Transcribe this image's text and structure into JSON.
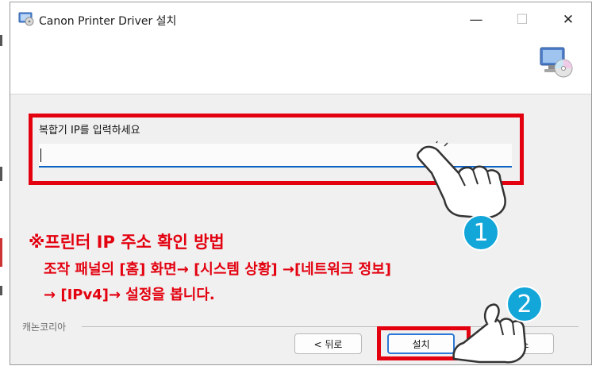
{
  "window": {
    "title": "Canon Printer Driver 설치",
    "controls": {
      "minimize": "—",
      "maximize": "☐",
      "close": "✕"
    }
  },
  "icons": {
    "app": "installer-app-icon",
    "header": "computer-cd-icon",
    "pointer": "pointing-hand-icon"
  },
  "form": {
    "ip_label": "복합기 IP를 입력하세요",
    "ip_value": "",
    "ip_placeholder": ""
  },
  "note": {
    "heading": "※프린터 IP 주소 확인 방법",
    "line1": "조작 패널의 [홈] 화면→ [시스템 상황] →[네트워크 정보]",
    "line2": "→ [IPv4]→ 설정을 봅니다."
  },
  "footer": {
    "brand": "캐논코리아",
    "back_label": "< 뒤로",
    "install_label": "설치",
    "cancel_label": "취소"
  },
  "badges": {
    "step1": "1",
    "step2": "2"
  },
  "colors": {
    "highlight": "#e3000f",
    "badge": "#13a6d9",
    "input_underline": "#0a63c4",
    "dialog_bg": "#f0f0f0"
  }
}
